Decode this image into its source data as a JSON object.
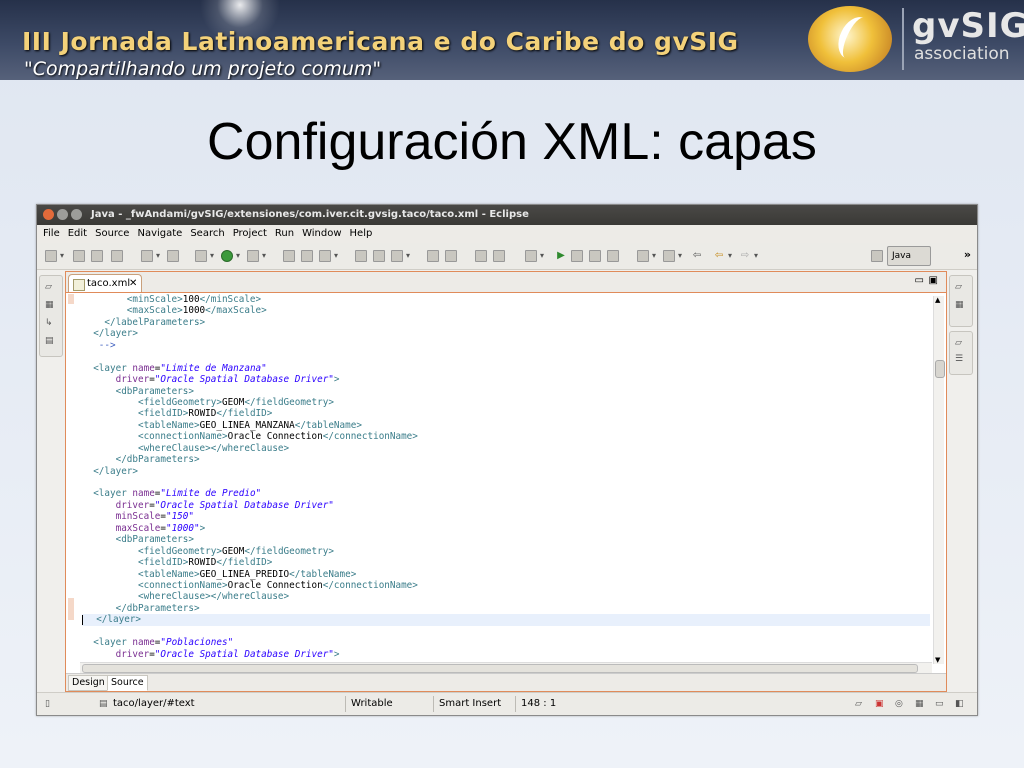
{
  "banner": {
    "line1": "III Jornada Latinoamericana e do Caribe do gvSIG",
    "line2": "\"Compartilhando um projeto comum\"",
    "logo_main": "gvSIG",
    "logo_sub": "association"
  },
  "slide": {
    "title": "Configuración XML: capas"
  },
  "window": {
    "title": "Java - _fwAndami/gvSIG/extensiones/com.iver.cit.gvsig.taco/taco.xml - Eclipse"
  },
  "menu": [
    "File",
    "Edit",
    "Source",
    "Navigate",
    "Search",
    "Project",
    "Run",
    "Window",
    "Help"
  ],
  "toolbar": {
    "perspective_label": "Java",
    "more_glyph": "»"
  },
  "editor": {
    "tab_label": "taco.xml",
    "tab_close_glyph": "✕",
    "minimize_glyph": "▭",
    "maximize_glyph": "▣",
    "lines": [
      "        <minScale>100</minScale>",
      "        <maxScale>1000</maxScale>",
      "    </labelParameters>",
      "  </layer>",
      "   -->",
      "",
      "  <layer name=\"Limite de Manzana\"",
      "      driver=\"Oracle Spatial Database Driver\">",
      "      <dbParameters>",
      "          <fieldGeometry>GEOM</fieldGeometry>",
      "          <fieldID>ROWID</fieldID>",
      "          <tableName>GEO_LINEA_MANZANA</tableName>",
      "          <connectionName>Oracle Connection</connectionName>",
      "          <whereClause></whereClause>",
      "      </dbParameters>",
      "  </layer>",
      "",
      "  <layer name=\"Limite de Predio\"",
      "      driver=\"Oracle Spatial Database Driver\"",
      "      minScale=\"150\"",
      "      maxScale=\"1000\">",
      "      <dbParameters>",
      "          <fieldGeometry>GEOM</fieldGeometry>",
      "          <fieldID>ROWID</fieldID>",
      "          <tableName>GEO_LINEA_PREDIO</tableName>",
      "          <connectionName>Oracle Connection</connectionName>",
      "          <whereClause></whereClause>",
      "      </dbParameters>",
      "  </layer>",
      "",
      "  <layer name=\"Poblaciones\"",
      "      driver=\"Oracle Spatial Database Driver\">"
    ],
    "current_line_index": 28,
    "bottom_tabs": [
      "Design",
      "Source"
    ],
    "active_bottom_tab": "Source"
  },
  "statusbar": {
    "path": "taco/layer/#text",
    "mode": "Writable",
    "insert_mode": "Smart Insert",
    "position": "148 : 1"
  },
  "colors": {
    "tag": "#3b7d8a",
    "attribute": "#7a2e91",
    "value": "#2a00ff",
    "editor_border": "#e08b5a",
    "banner_text": "#f4d27a"
  }
}
